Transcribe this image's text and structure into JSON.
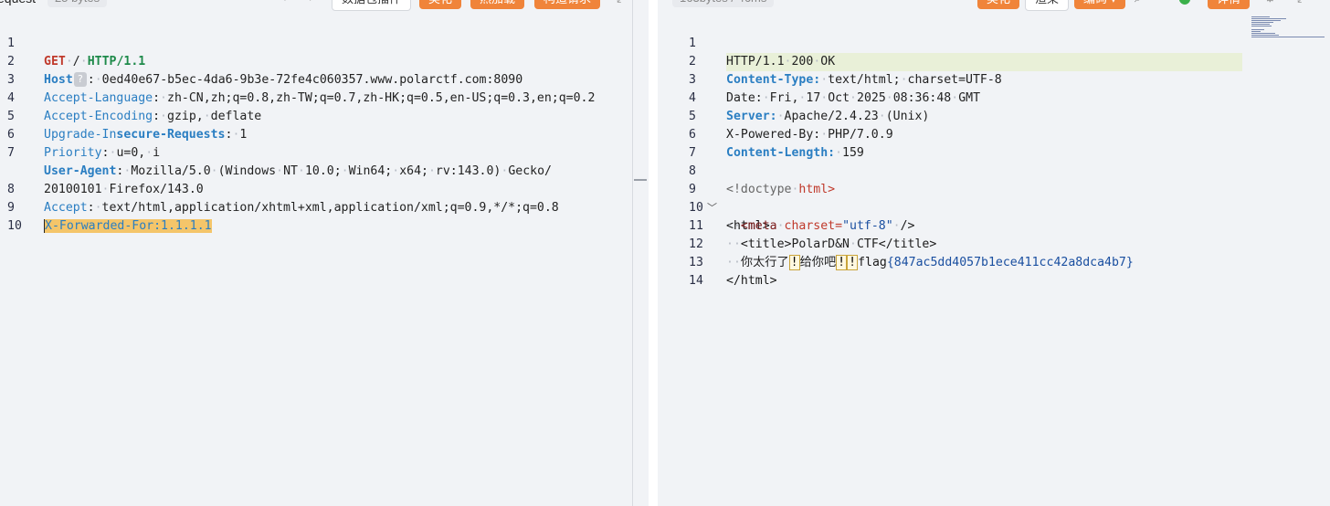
{
  "request": {
    "label": "equest",
    "size": "25 bytes",
    "toolbar": {
      "nav_prev": "‹",
      "nav_next": "›",
      "data_btn": "数据包插件",
      "btn1": "美化",
      "btn2": "热加载",
      "btn3": "构造请求",
      "expand_icon": "⤢"
    },
    "lines": [
      {
        "n": "1"
      },
      {
        "n": "2"
      },
      {
        "n": "3"
      },
      {
        "n": "4"
      },
      {
        "n": "5"
      },
      {
        "n": "6"
      },
      {
        "n": "7"
      },
      {
        "n": ""
      },
      {
        "n": "8"
      },
      {
        "n": "9"
      },
      {
        "n": "10"
      }
    ],
    "method": "GET",
    "path": "/",
    "version": "HTTP/1.1",
    "headers": {
      "host_key": "Host",
      "host_val": "0ed40e67-b5ec-4da6-9b3e-72fe4c060357.www.polarctf.com:8090",
      "al_key": "Accept-Language",
      "al_val": "zh-CN,zh;q=0.8,zh-TW;q=0.7,zh-HK;q=0.5,en-US;q=0.3,en;q=0.2",
      "ae_key": "Accept-Encoding",
      "ae_val_a": "gzip,",
      "ae_val_b": "deflate",
      "uir_key_a": "Upgrade-In",
      "uir_key_b": "secure-Requests",
      "uir_val": "1",
      "pri_key": "Priority",
      "pri_val_a": "u=0,",
      "pri_val_b": "i",
      "ua_key": "User-Agent",
      "ua_p1": "Mozilla/5.0",
      "ua_p2": "(Windows",
      "ua_p3": "NT",
      "ua_p4": "10.0;",
      "ua_p5": "Win64;",
      "ua_p6": "x64;",
      "ua_p7": "rv:143.0)",
      "ua_p8": "Gecko/",
      "ua_p9": "20100101",
      "ua_p10": "Firefox/143.0",
      "acc_key": "Accept",
      "acc_val": "text/html,application/xhtml+xml,application/xml;q=0.9,*/*;q=0.8",
      "xff": "X-Forwarded-For:1.1.1.1"
    }
  },
  "response": {
    "size": "163bytes / 46ms",
    "toolbar": {
      "btn1": "美化",
      "btn2": "渲染",
      "btn3": "编码 ▾",
      "search_icon": "⌕",
      "btn4": "详情",
      "gear_icon": "⚙",
      "expand_icon": "⤢"
    },
    "lines": [
      {
        "n": "1"
      },
      {
        "n": "2"
      },
      {
        "n": "3"
      },
      {
        "n": "4"
      },
      {
        "n": "5"
      },
      {
        "n": "6"
      },
      {
        "n": "7"
      },
      {
        "n": "8"
      },
      {
        "n": "9"
      },
      {
        "n": "10"
      },
      {
        "n": "11"
      },
      {
        "n": "12"
      },
      {
        "n": "13"
      },
      {
        "n": "14"
      }
    ],
    "status_a": "HTTP/1.1",
    "status_b": "200",
    "status_c": "OK",
    "ct_key": "Content-Type:",
    "ct_val_a": "text/html;",
    "ct_val_b": "charset=UTF-8",
    "date_key": "Date:",
    "date_parts": [
      "Fri,",
      "17",
      "Oct",
      "2025",
      "08:36:48",
      "GMT"
    ],
    "server_key": "Server:",
    "server_val_a": "Apache/2.4.23",
    "server_val_b": "(Unix)",
    "xpb_key": "X-Powered-By:",
    "xpb_val": "PHP/7.0.9",
    "cl_key": "Content-Length:",
    "cl_val": "159",
    "doctype_a": "<!doctype",
    "doctype_b": "html>",
    "html_open": "<html>",
    "meta_tag": "<meta",
    "meta_attr": "charset=",
    "meta_val": "\"utf-8\"",
    "meta_close": "/>",
    "title_open": "<title>",
    "title_text_a": "PolarD&N",
    "title_text_b": "CTF",
    "title_close": "</title>",
    "body_a": "你太行了",
    "body_b": "!",
    "body_c": "给你吧",
    "body_d": "!",
    "body_e": "!",
    "flag_a": "flag",
    "flag_b": "{847ac5dd4057b1ece411cc42a8dca4b7}",
    "html_close": "</html>"
  },
  "colors": {
    "accent": "#f0843a",
    "selection": "#f4c56a",
    "editor_bg": "#f1f3f6"
  }
}
